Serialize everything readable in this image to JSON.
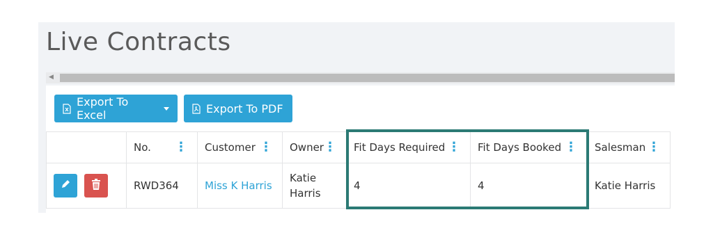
{
  "page": {
    "title": "Live Contracts"
  },
  "toolbar": {
    "export_excel_label": "Export To Excel",
    "export_pdf_label": "Export To PDF"
  },
  "table": {
    "columns": [
      "No.",
      "Customer",
      "Owner",
      "Fit Days Required",
      "Fit Days Booked",
      "Salesman"
    ],
    "rows": [
      {
        "no": "RWD364",
        "customer": "Miss K Harris",
        "owner": "Katie Harris",
        "fit_days_required": "4",
        "fit_days_booked": "4",
        "salesman": "Katie Harris"
      }
    ]
  },
  "colors": {
    "accent": "#2ea3d6",
    "danger": "#d9534f",
    "highlight": "#2b7a74"
  },
  "icons": [
    "excel-file-icon",
    "caret-down-icon",
    "pdf-file-icon",
    "column-menu-icon",
    "pencil-icon",
    "trash-icon"
  ]
}
